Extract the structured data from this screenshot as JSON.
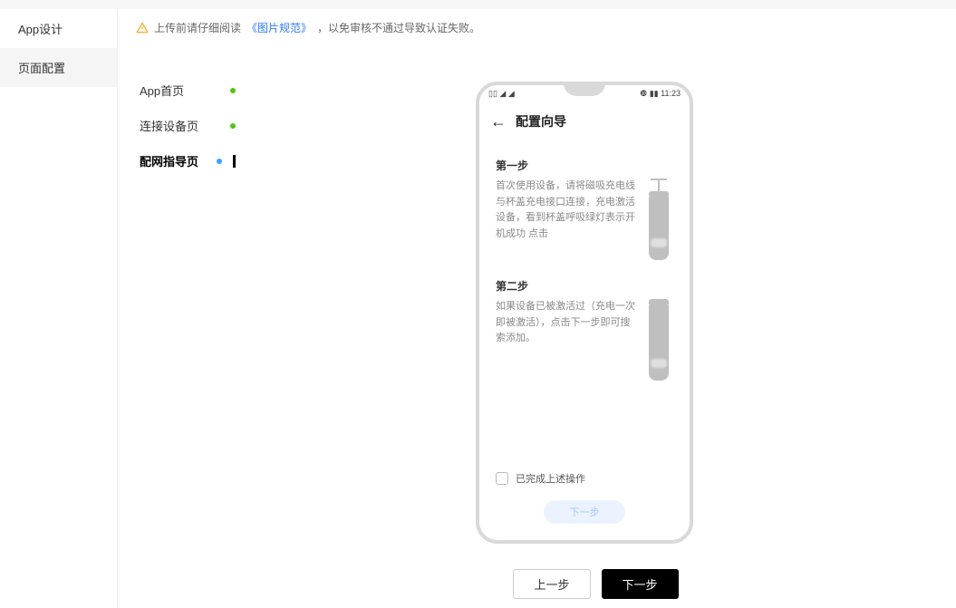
{
  "sidebar": {
    "items": [
      {
        "label": "App设计"
      },
      {
        "label": "页面配置"
      }
    ],
    "active_index": 1
  },
  "warning": {
    "prefix": "上传前请仔细阅读",
    "link": "《图片规范》",
    "suffix": "，以免审核不通过导致认证失败。"
  },
  "subnav": {
    "items": [
      {
        "label": "App首页",
        "status": "green"
      },
      {
        "label": "连接设备页",
        "status": "green"
      },
      {
        "label": "配网指导页",
        "status": "blue"
      }
    ],
    "active_index": 2
  },
  "phone": {
    "status_left": "▯▯ ◢ ◢",
    "status_right": "❿ ▮▮ 11:23",
    "title": "配置向导",
    "steps": [
      {
        "title": "第一步",
        "desc": "首次使用设备，请将磁吸充电线与杯盖充电接口连接，充电激活设备，看到杯盖呼吸绿灯表示开机成功    点击"
      },
      {
        "title": "第二步",
        "desc": "如果设备已被激活过（充电一次即被激活），点击下一步即可搜索添加。"
      }
    ],
    "confirm_label": "已完成上述操作",
    "next_label": "下一步"
  },
  "footer": {
    "prev": "上一步",
    "next": "下一步"
  }
}
